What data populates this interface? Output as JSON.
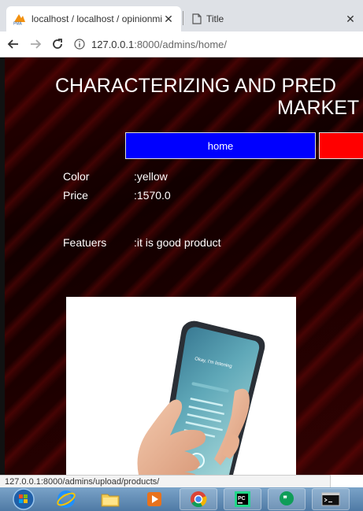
{
  "browser": {
    "tabs": [
      {
        "title": "localhost / localhost / opinionmi",
        "icon": "phpmyadmin-icon",
        "active": true
      },
      {
        "title": "Title",
        "icon": "document-icon",
        "active": false
      }
    ],
    "url": {
      "host": "127.0.0.1",
      "path": ":8000/admins/home/"
    },
    "status_url": "127.0.0.1:8000/admins/upload/products/"
  },
  "page": {
    "heading_line1": "CHARACTERIZING AND PRED",
    "heading_line2": "MARKET",
    "nav": {
      "home_label": "home"
    },
    "details": [
      {
        "label": "Color",
        "value": ":yellow"
      },
      {
        "label": "Price",
        "value": ":1570.0"
      },
      {
        "label": "Featuers",
        "value": ":it is good product"
      }
    ],
    "product_image_icon": "smartphone-in-hand-image",
    "phone_screen_text": "Okay, I'm listening"
  },
  "taskbar": {
    "items": [
      "start-orb-icon",
      "internet-explorer-icon",
      "file-explorer-icon",
      "media-player-icon",
      "chrome-icon",
      "pycharm-icon",
      "hangouts-icon",
      "command-prompt-icon"
    ]
  },
  "colors": {
    "nav_home": "#0000ff",
    "nav_other": "#ff0000",
    "page_bg": "#1a0000"
  }
}
